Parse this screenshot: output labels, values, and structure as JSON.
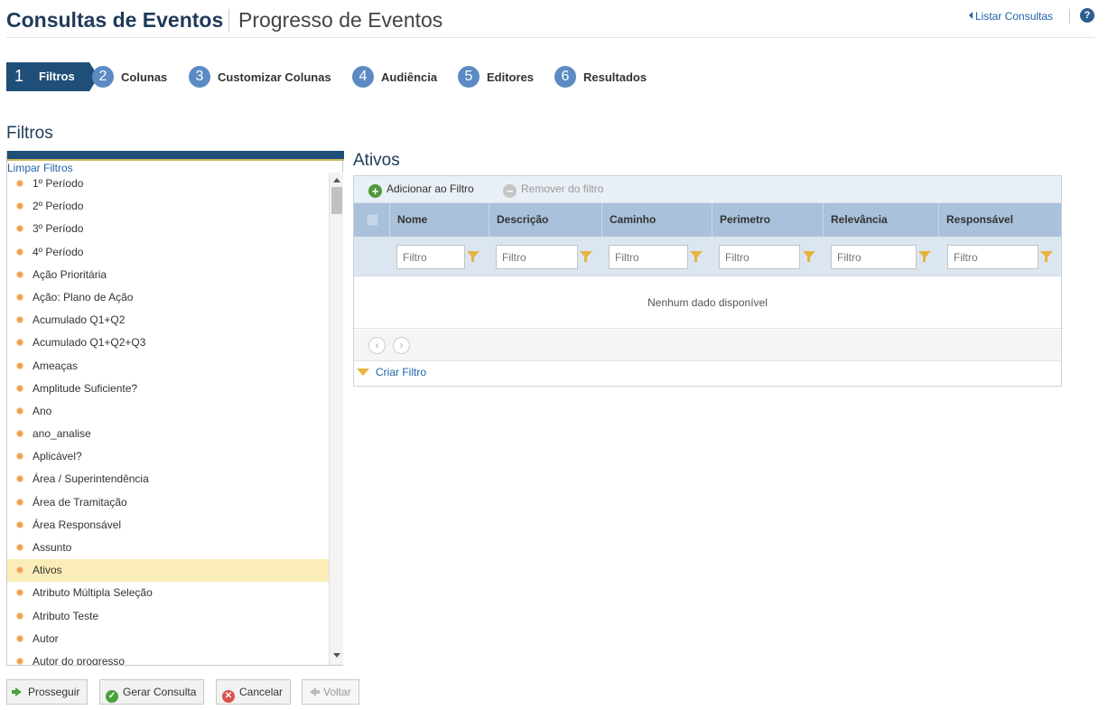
{
  "header": {
    "title": "Consultas de Eventos",
    "subtitle": "Progresso de Eventos",
    "list_link": "Listar Consultas",
    "help_glyph": "?"
  },
  "steps": [
    {
      "num": "1",
      "label": "Filtros",
      "active": true
    },
    {
      "num": "2",
      "label": "Colunas"
    },
    {
      "num": "3",
      "label": "Customizar Colunas"
    },
    {
      "num": "4",
      "label": "Audiência"
    },
    {
      "num": "5",
      "label": "Editores"
    },
    {
      "num": "6",
      "label": "Resultados"
    }
  ],
  "filters": {
    "title": "Filtros",
    "clear_link": "Limpar Filtros",
    "items": [
      "1º Período",
      "2º Período",
      "3º Período",
      "4º Período",
      "Ação Prioritária",
      "Ação: Plano de Ação",
      "Acumulado Q1+Q2",
      "Acumulado Q1+Q2+Q3",
      "Ameaças",
      "Amplitude Suficiente?",
      "Ano",
      "ano_analise",
      "Aplicável?",
      "Área / Superintendência",
      "Área de Tramitação",
      "Área Responsável",
      "Assunto",
      "Ativos",
      "Atributo Múltipla Seleção",
      "Atributo Teste",
      "Autor",
      "Autor do progresso"
    ],
    "selected_item": "Ativos"
  },
  "active_panel": {
    "title": "Ativos",
    "add_button": "Adicionar ao Filtro",
    "remove_button": "Remover do filtro",
    "columns": [
      "Nome",
      "Descrição",
      "Caminho",
      "Perimetro",
      "Relevância",
      "Responsável"
    ],
    "filter_placeholder": "Filtro",
    "empty_message": "Nenhum dado disponível",
    "create_filter": "Criar Filtro",
    "pager_prev": "‹",
    "pager_next": "›"
  },
  "buttons": {
    "proceed": "Prosseguir",
    "generate": "Gerar Consulta",
    "cancel": "Cancelar",
    "back": "Voltar",
    "check_glyph": "✓",
    "cancel_glyph": "✕",
    "add_glyph": "+",
    "remove_glyph": "−"
  },
  "colors": {
    "primary": "#1f4e79",
    "step_circle": "#5b8bc2",
    "selected_row": "#fbedb7",
    "link": "#2062a8"
  }
}
